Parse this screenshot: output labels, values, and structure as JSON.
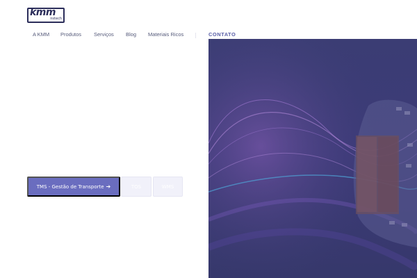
{
  "brand": {
    "logo_text": "kmm",
    "logo_subtext": "nstech"
  },
  "nav": {
    "items": [
      {
        "label": "A KMM"
      },
      {
        "label": "Produtos"
      },
      {
        "label": "Serviços"
      },
      {
        "label": "Blog"
      },
      {
        "label": "Materiais Ricos"
      }
    ],
    "contact_label": "CONTATO"
  },
  "tabs": [
    {
      "label": "TMS - Gestão de Transporte",
      "icon": "arrow-right-icon",
      "active": true
    },
    {
      "label": "TOS",
      "active": false
    },
    {
      "label": "WMS",
      "active": false
    }
  ],
  "colors": {
    "brand_dark": "#2b2d5a",
    "accent": "#6a6dbf",
    "hero_bg": "#3a3c73"
  }
}
